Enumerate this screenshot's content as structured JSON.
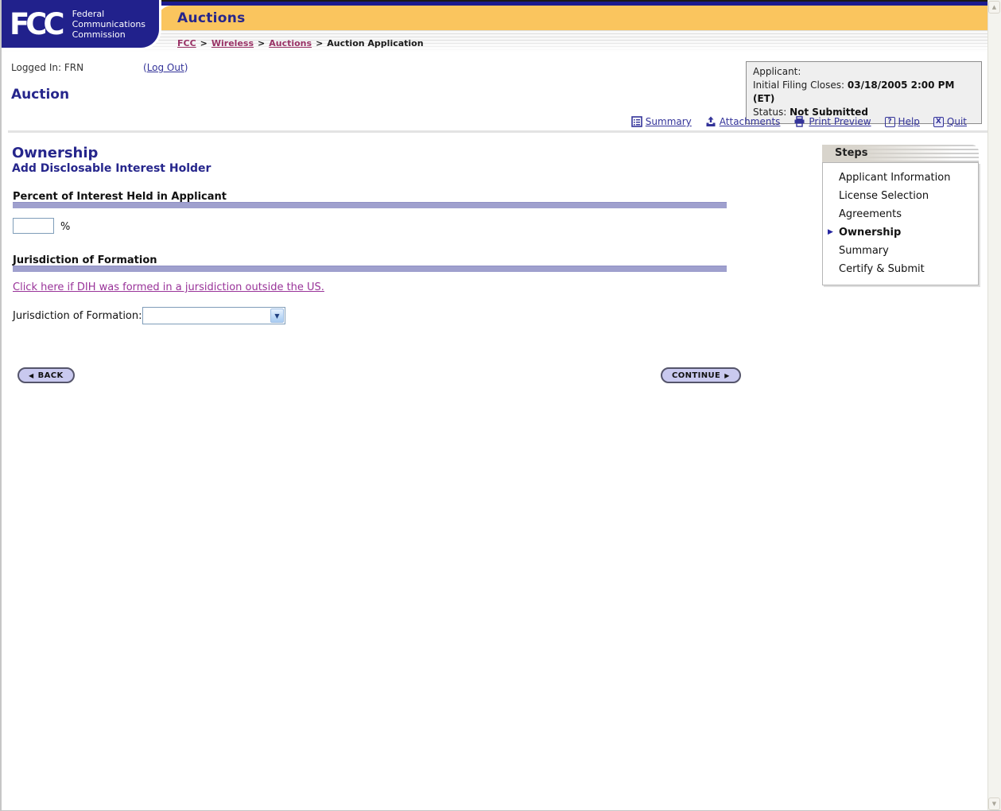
{
  "header": {
    "logo": {
      "fcc_text": "FCC",
      "org_lines": [
        "Federal",
        "Communications",
        "Commission"
      ]
    },
    "app_title": "Auctions",
    "breadcrumb": {
      "links": [
        "FCC",
        "Wireless",
        "Auctions"
      ],
      "separator": ">",
      "current": "Auction Application"
    }
  },
  "session": {
    "logged_in": "Logged In: FRN",
    "logout_prefix": "(",
    "logout_label": "Log Out",
    "logout_suffix": ")"
  },
  "page_title": "Auction",
  "applicant_box": {
    "applicant_label": "Applicant:",
    "filing_label": "Initial Filing Closes:",
    "filing_value": "03/18/2005 2:00 PM (ET)",
    "status_label": "Status:",
    "status_value": "Not Submitted"
  },
  "toolbar": {
    "items": [
      {
        "label": "Summary",
        "icon": "summary-icon"
      },
      {
        "label": "Attachments",
        "icon": "attachments-icon"
      },
      {
        "label": "Print Preview",
        "icon": "print-preview-icon"
      },
      {
        "label": "Help",
        "icon": "help-icon",
        "glyph": "?"
      },
      {
        "label": "Quit",
        "icon": "quit-icon",
        "glyph": "X"
      }
    ]
  },
  "content": {
    "section_title": "Ownership",
    "section_subtitle": "Add Disclosable Interest Holder",
    "percent": {
      "heading": "Percent of Interest Held in Applicant",
      "input_value": "",
      "suffix": "%"
    },
    "jurisdiction": {
      "heading": "Jurisdiction of Formation",
      "outside_us_link": "Click here if DIH was formed in a jursidiction outside the US.",
      "field_label": "Jurisdiction of Formation:",
      "select_value": ""
    },
    "back_button": "BACK",
    "continue_button": "CONTINUE"
  },
  "steps": {
    "title": "Steps",
    "items": [
      {
        "label": "Applicant Information",
        "active": false
      },
      {
        "label": "License Selection",
        "active": false
      },
      {
        "label": "Agreements",
        "active": false
      },
      {
        "label": "Ownership",
        "active": true
      },
      {
        "label": "Summary",
        "active": false
      },
      {
        "label": "Certify & Submit",
        "active": false
      }
    ]
  },
  "icons": {
    "step_arrow": "▶",
    "back_arrow": "◀",
    "continue_arrow": "▶",
    "dropdown_arrow": "▼",
    "scroll_up": "▲",
    "scroll_down": "▼"
  },
  "colors": {
    "navy_logo_bg": "#21218C",
    "heading_navy": "#26268C",
    "gold_bar": "#FAC55E",
    "purple_bar": "#9FA0CE",
    "breadcrumb_link": "#993366",
    "toolbar_link": "#333399",
    "dih_link": "#993399",
    "button_fill": "#C9C9EF",
    "box_bg": "#EFEFEF"
  }
}
